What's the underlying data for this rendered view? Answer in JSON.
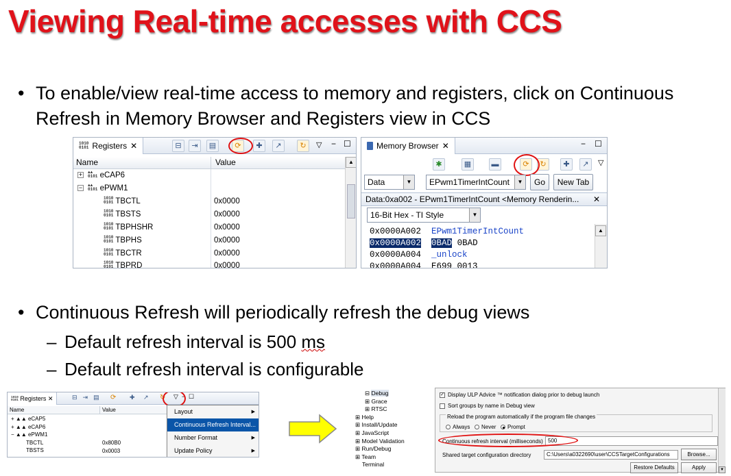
{
  "slide": {
    "title": "Viewing Real-time accesses with CCS",
    "bullet1": "To enable/view real-time access to memory and registers, click on Continuous Refresh in Memory Browser and Registers view in CCS",
    "bullet2": "Continuous Refresh will periodically refresh the debug views",
    "sub1_pre": "Default refresh interval is 500 ",
    "sub1_unit": "ms",
    "sub2": "Default refresh interval is configurable",
    "bullet_glyph": "•",
    "dash_glyph": "–"
  },
  "registers_view": {
    "tab_label": "Registers",
    "col_name": "Name",
    "col_value": "Value",
    "rows": [
      {
        "name": "eCAP6",
        "value": "",
        "expander": "+"
      },
      {
        "name": "ePWM1",
        "value": "",
        "expander": "−"
      },
      {
        "name": "TBCTL",
        "value": "0x0000"
      },
      {
        "name": "TBSTS",
        "value": "0x0000"
      },
      {
        "name": "TBPHSHR",
        "value": "0x0000"
      },
      {
        "name": "TBPHS",
        "value": "0x0000"
      },
      {
        "name": "TBCTR",
        "value": "0x0000"
      },
      {
        "name": "TBPRD",
        "value": "0x0000"
      }
    ]
  },
  "memory_view": {
    "tab_label": "Memory Browser",
    "space_select": "Data",
    "address_input": "EPwm1TimerIntCount",
    "go_button": "Go",
    "new_tab_button": "New Tab",
    "rendering_tab": "Data:0xa002 - EPwm1TimerIntCount <Memory Renderin...",
    "format_select": "16-Bit Hex - TI Style",
    "lines": [
      {
        "addr": "0x0000A002",
        "data": "EPwm1TimerIntCount",
        "sym": true
      },
      {
        "addr": "0x0000A002",
        "data": "0BAD",
        "data2": "0BAD",
        "selected": true
      },
      {
        "addr": "0x0000A004",
        "data": "_unlock",
        "sym": true
      },
      {
        "addr": "0x0000A004",
        "data": "E699 0013"
      }
    ]
  },
  "small_registers": {
    "tab_label": "Registers",
    "col_name": "Name",
    "col_value": "Value",
    "rows": [
      {
        "name": "eCAP5",
        "value": "",
        "expander": "+"
      },
      {
        "name": "eCAP6",
        "value": "",
        "expander": "+"
      },
      {
        "name": "ePWM1",
        "value": "",
        "expander": "−"
      },
      {
        "name": "TBCTL",
        "value": "0x80B0"
      },
      {
        "name": "TBSTS",
        "value": "0x0003"
      }
    ],
    "menu": [
      "Layout",
      "Continuous Refresh Interval...",
      "Number Format",
      "Update Policy"
    ]
  },
  "pref_tree": [
    "Debug",
    "Grace",
    "RTSC",
    "Help",
    "Install/Update",
    "JavaScript",
    "Model Validation",
    "Run/Debug",
    "Team",
    "Terminal"
  ],
  "prefs": {
    "ulp_advice": "Display ULP Advice ™ notification dialog prior to debug launch",
    "sort_groups": "Sort groups by name in Debug view",
    "reload_group": "Reload the program automatically if the program file changes",
    "radio_always": "Always",
    "radio_never": "Never",
    "radio_prompt": "Prompt",
    "interval_label": "Continuous refresh interval (milliseconds)",
    "interval_value": "500",
    "shared_label": "Shared target configuration directory",
    "shared_value": "C:\\Users\\a0322690\\user\\CCSTargetConfigurations",
    "browse": "Browse...",
    "restore": "Restore Defaults",
    "apply": "Apply"
  },
  "colors": {
    "title": "#e0121a",
    "annotation": "#e01010",
    "arrow_fill": "#ffff00",
    "selection": "#0a55a8"
  }
}
